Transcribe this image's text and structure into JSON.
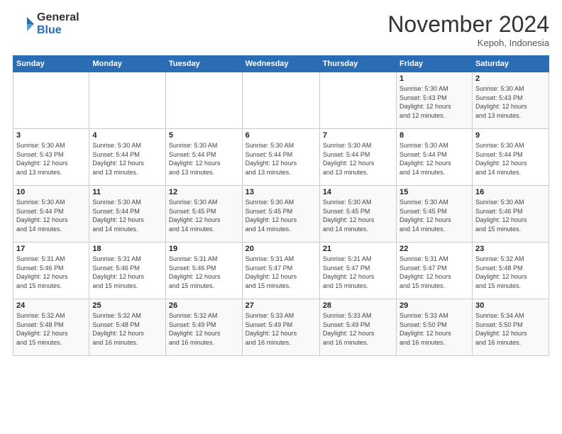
{
  "logo": {
    "general": "General",
    "blue": "Blue"
  },
  "header": {
    "month": "November 2024",
    "location": "Kepoh, Indonesia"
  },
  "days_of_week": [
    "Sunday",
    "Monday",
    "Tuesday",
    "Wednesday",
    "Thursday",
    "Friday",
    "Saturday"
  ],
  "weeks": [
    [
      {
        "day": "",
        "info": ""
      },
      {
        "day": "",
        "info": ""
      },
      {
        "day": "",
        "info": ""
      },
      {
        "day": "",
        "info": ""
      },
      {
        "day": "",
        "info": ""
      },
      {
        "day": "1",
        "info": "Sunrise: 5:30 AM\nSunset: 5:43 PM\nDaylight: 12 hours\nand 12 minutes."
      },
      {
        "day": "2",
        "info": "Sunrise: 5:30 AM\nSunset: 5:43 PM\nDaylight: 12 hours\nand 13 minutes."
      }
    ],
    [
      {
        "day": "3",
        "info": "Sunrise: 5:30 AM\nSunset: 5:43 PM\nDaylight: 12 hours\nand 13 minutes."
      },
      {
        "day": "4",
        "info": "Sunrise: 5:30 AM\nSunset: 5:44 PM\nDaylight: 12 hours\nand 13 minutes."
      },
      {
        "day": "5",
        "info": "Sunrise: 5:30 AM\nSunset: 5:44 PM\nDaylight: 12 hours\nand 13 minutes."
      },
      {
        "day": "6",
        "info": "Sunrise: 5:30 AM\nSunset: 5:44 PM\nDaylight: 12 hours\nand 13 minutes."
      },
      {
        "day": "7",
        "info": "Sunrise: 5:30 AM\nSunset: 5:44 PM\nDaylight: 12 hours\nand 13 minutes."
      },
      {
        "day": "8",
        "info": "Sunrise: 5:30 AM\nSunset: 5:44 PM\nDaylight: 12 hours\nand 14 minutes."
      },
      {
        "day": "9",
        "info": "Sunrise: 5:30 AM\nSunset: 5:44 PM\nDaylight: 12 hours\nand 14 minutes."
      }
    ],
    [
      {
        "day": "10",
        "info": "Sunrise: 5:30 AM\nSunset: 5:44 PM\nDaylight: 12 hours\nand 14 minutes."
      },
      {
        "day": "11",
        "info": "Sunrise: 5:30 AM\nSunset: 5:44 PM\nDaylight: 12 hours\nand 14 minutes."
      },
      {
        "day": "12",
        "info": "Sunrise: 5:30 AM\nSunset: 5:45 PM\nDaylight: 12 hours\nand 14 minutes."
      },
      {
        "day": "13",
        "info": "Sunrise: 5:30 AM\nSunset: 5:45 PM\nDaylight: 12 hours\nand 14 minutes."
      },
      {
        "day": "14",
        "info": "Sunrise: 5:30 AM\nSunset: 5:45 PM\nDaylight: 12 hours\nand 14 minutes."
      },
      {
        "day": "15",
        "info": "Sunrise: 5:30 AM\nSunset: 5:45 PM\nDaylight: 12 hours\nand 14 minutes."
      },
      {
        "day": "16",
        "info": "Sunrise: 5:30 AM\nSunset: 5:46 PM\nDaylight: 12 hours\nand 15 minutes."
      }
    ],
    [
      {
        "day": "17",
        "info": "Sunrise: 5:31 AM\nSunset: 5:46 PM\nDaylight: 12 hours\nand 15 minutes."
      },
      {
        "day": "18",
        "info": "Sunrise: 5:31 AM\nSunset: 5:46 PM\nDaylight: 12 hours\nand 15 minutes."
      },
      {
        "day": "19",
        "info": "Sunrise: 5:31 AM\nSunset: 5:46 PM\nDaylight: 12 hours\nand 15 minutes."
      },
      {
        "day": "20",
        "info": "Sunrise: 5:31 AM\nSunset: 5:47 PM\nDaylight: 12 hours\nand 15 minutes."
      },
      {
        "day": "21",
        "info": "Sunrise: 5:31 AM\nSunset: 5:47 PM\nDaylight: 12 hours\nand 15 minutes."
      },
      {
        "day": "22",
        "info": "Sunrise: 5:31 AM\nSunset: 5:47 PM\nDaylight: 12 hours\nand 15 minutes."
      },
      {
        "day": "23",
        "info": "Sunrise: 5:32 AM\nSunset: 5:48 PM\nDaylight: 12 hours\nand 15 minutes."
      }
    ],
    [
      {
        "day": "24",
        "info": "Sunrise: 5:32 AM\nSunset: 5:48 PM\nDaylight: 12 hours\nand 15 minutes."
      },
      {
        "day": "25",
        "info": "Sunrise: 5:32 AM\nSunset: 5:48 PM\nDaylight: 12 hours\nand 16 minutes."
      },
      {
        "day": "26",
        "info": "Sunrise: 5:32 AM\nSunset: 5:49 PM\nDaylight: 12 hours\nand 16 minutes."
      },
      {
        "day": "27",
        "info": "Sunrise: 5:33 AM\nSunset: 5:49 PM\nDaylight: 12 hours\nand 16 minutes."
      },
      {
        "day": "28",
        "info": "Sunrise: 5:33 AM\nSunset: 5:49 PM\nDaylight: 12 hours\nand 16 minutes."
      },
      {
        "day": "29",
        "info": "Sunrise: 5:33 AM\nSunset: 5:50 PM\nDaylight: 12 hours\nand 16 minutes."
      },
      {
        "day": "30",
        "info": "Sunrise: 5:34 AM\nSunset: 5:50 PM\nDaylight: 12 hours\nand 16 minutes."
      }
    ]
  ]
}
